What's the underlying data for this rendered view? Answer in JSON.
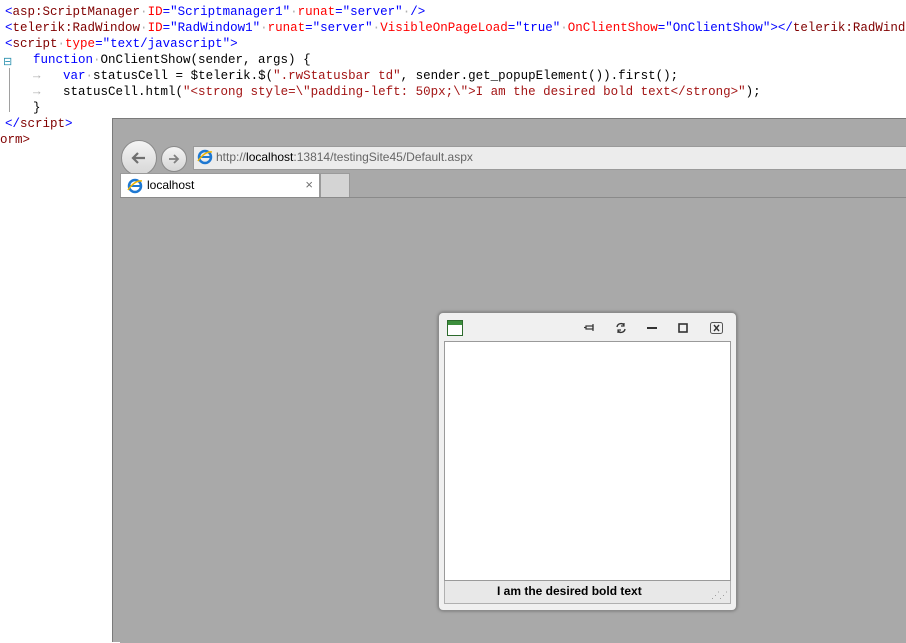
{
  "code": {
    "line1": {
      "tag": "asp:ScriptManager",
      "attr_id": "ID",
      "val_id": "\"Scriptmanager1\"",
      "attr_runat": "runat",
      "val_runat": "\"server\"",
      "close": "/>"
    },
    "line2": {
      "tag": "telerik:RadWindow",
      "attr_id": "ID",
      "val_id": "\"RadWindow1\"",
      "attr_runat": "runat",
      "val_runat": "\"server\"",
      "attr_visible": "VisibleOnPageLoad",
      "val_visible": "\"true\"",
      "attr_onshow": "OnClientShow",
      "val_onshow": "\"OnClientShow\"",
      "close_tag": "telerik:RadWindow"
    },
    "line3": {
      "tag": "script",
      "attr_type": "type",
      "val_type": "\"text/javascript\""
    },
    "line4": {
      "kw": "function",
      "rest": "OnClientShow(sender, args) {"
    },
    "line5": {
      "kw": "var",
      "a": "statusCell = $telerik.$(",
      "str": "\".rwStatusbar td\"",
      "b": ", sender.get_popupElement()).first();"
    },
    "line6": {
      "a": "statusCell.html(",
      "str": "\"<strong style=\\\"padding-left: 50px;\\\">I am the desired bold text</strong>\"",
      "b": ");"
    },
    "line7": "}",
    "line8": {
      "tag": "script"
    },
    "line9": {
      "text": "orm>"
    }
  },
  "browser": {
    "address": {
      "prefix": "http://",
      "host": "localhost",
      "suffix": ":13814/testingSite45/Default.aspx"
    },
    "tab_title": "localhost",
    "tab_close": "×",
    "back_icon": "back-arrow-icon",
    "forward_icon": "forward-arrow-icon"
  },
  "radwindow": {
    "status_text": "I am the desired bold text",
    "buttons": [
      "pin",
      "reload",
      "minimize",
      "maximize",
      "close"
    ]
  }
}
